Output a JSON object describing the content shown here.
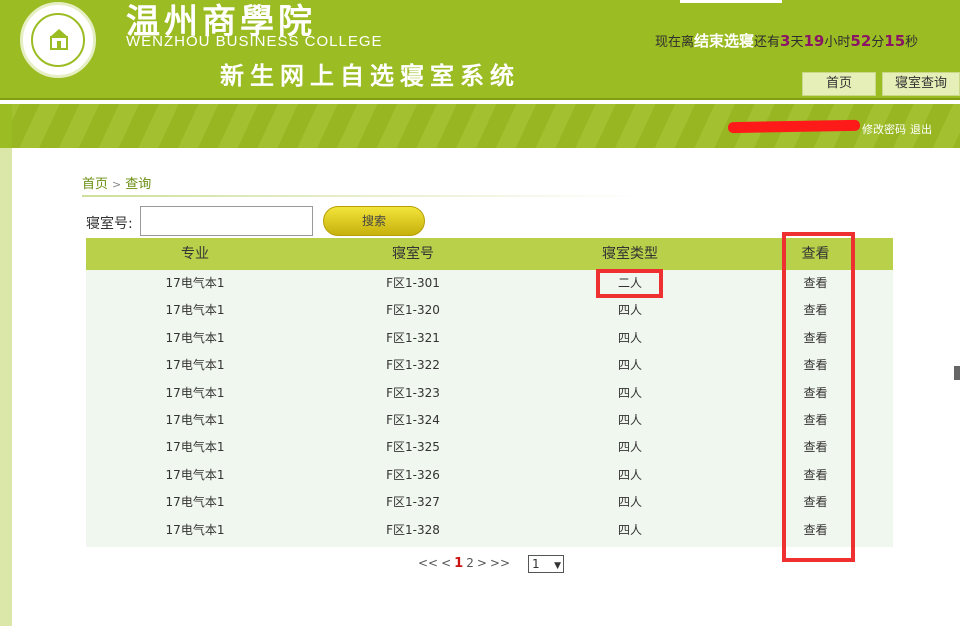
{
  "header": {
    "school_cn": "温州商學院",
    "school_en": "WENZHOU BUSINESS COLLEGE",
    "system_name": "新生网上自选寝室系统",
    "countdown": {
      "prefix": "现在离",
      "event": "结束选寝",
      "mid": "还有",
      "days": "3",
      "days_unit": "天",
      "hours": "19",
      "hours_unit": "小时",
      "minutes": "52",
      "minutes_unit": "分",
      "seconds": "15",
      "seconds_unit": "秒"
    },
    "nav": {
      "home": "首页",
      "dorm_query": "寝室查询"
    }
  },
  "userbar": {
    "change_password": "修改密码",
    "logout": "退出"
  },
  "breadcrumb": {
    "home": "首页",
    "separator": ">",
    "current": "查询"
  },
  "search": {
    "label": "寝室号:",
    "value": "",
    "button": "搜索"
  },
  "table": {
    "headers": {
      "major": "专业",
      "room": "寝室号",
      "type": "寝室类型",
      "view": "查看"
    },
    "rows": [
      {
        "major": "17电气本1",
        "room": "F区1-301",
        "type": "二人",
        "view": "查看"
      },
      {
        "major": "17电气本1",
        "room": "F区1-320",
        "type": "四人",
        "view": "查看"
      },
      {
        "major": "17电气本1",
        "room": "F区1-321",
        "type": "四人",
        "view": "查看"
      },
      {
        "major": "17电气本1",
        "room": "F区1-322",
        "type": "四人",
        "view": "查看"
      },
      {
        "major": "17电气本1",
        "room": "F区1-323",
        "type": "四人",
        "view": "查看"
      },
      {
        "major": "17电气本1",
        "room": "F区1-324",
        "type": "四人",
        "view": "查看"
      },
      {
        "major": "17电气本1",
        "room": "F区1-325",
        "type": "四人",
        "view": "查看"
      },
      {
        "major": "17电气本1",
        "room": "F区1-326",
        "type": "四人",
        "view": "查看"
      },
      {
        "major": "17电气本1",
        "room": "F区1-327",
        "type": "四人",
        "view": "查看"
      },
      {
        "major": "17电气本1",
        "room": "F区1-328",
        "type": "四人",
        "view": "查看"
      }
    ]
  },
  "pagination": {
    "first": "<<",
    "prev": "<",
    "pages": [
      "1",
      "2"
    ],
    "current": "1",
    "next": ">",
    "last": ">>",
    "select_value": "1"
  },
  "colors": {
    "brand_green": "#9cbc23",
    "table_header": "#b9d04a",
    "annotation_red": "#ef3030",
    "current_page": "#cc1111"
  }
}
